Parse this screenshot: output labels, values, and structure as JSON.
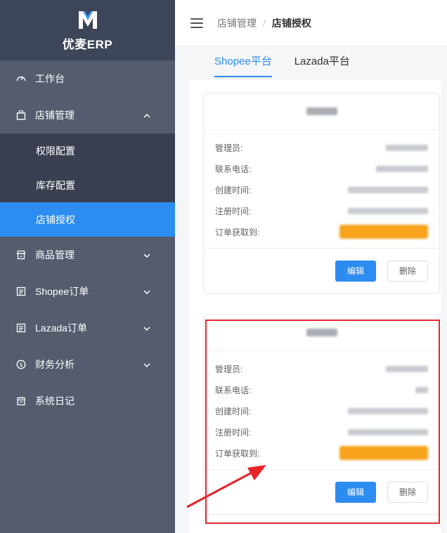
{
  "app": {
    "name": "优麦ERP"
  },
  "sidebar": {
    "items": [
      {
        "label": "工作台"
      },
      {
        "label": "店铺管理",
        "children": [
          {
            "label": "权限配置"
          },
          {
            "label": "库存配置"
          },
          {
            "label": "店铺授权"
          }
        ]
      },
      {
        "label": "商品管理"
      },
      {
        "label": "Shopee订单"
      },
      {
        "label": "Lazada订单"
      },
      {
        "label": "财务分析"
      },
      {
        "label": "系统日记"
      }
    ]
  },
  "header": {
    "breadcrumb": {
      "parent": "店铺管理",
      "separator": "/",
      "current": "店铺授权"
    }
  },
  "tabs": [
    {
      "label": "Shopee平台"
    },
    {
      "label": "Lazada平台"
    }
  ],
  "fields": {
    "admin": "管理员:",
    "phone": "联系电话:",
    "created": "创建时间:",
    "registered": "注册时间:",
    "order_fetch": "订单获取到:"
  },
  "buttons": {
    "edit": "编辑",
    "delete": "删除"
  },
  "colors": {
    "accent": "#2d8cf0",
    "sidebar": "#545c6e",
    "sidebar_dark": "#3a4052",
    "highlight": "#e8242b",
    "redacted": "#f7a31b"
  }
}
